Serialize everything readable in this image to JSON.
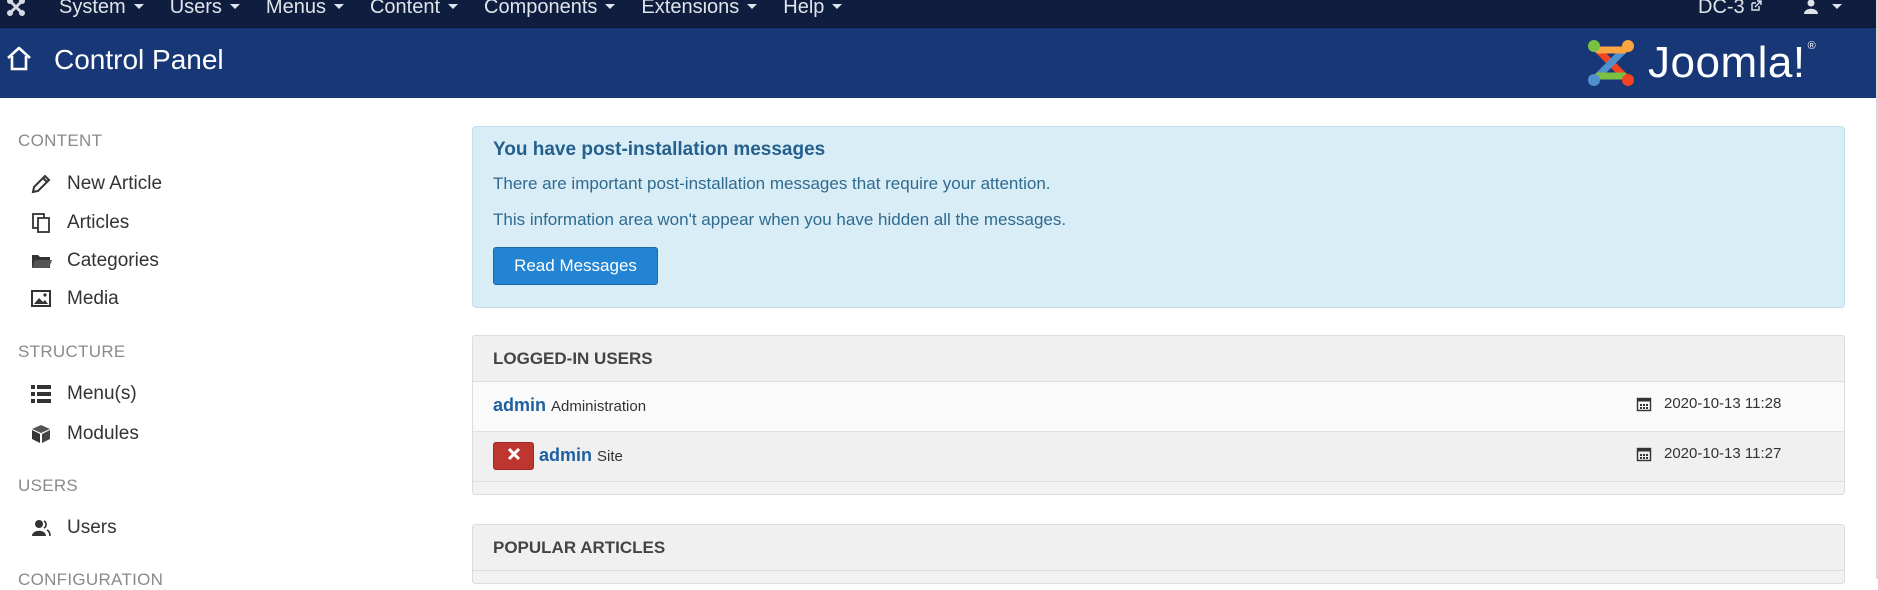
{
  "topnav": {
    "brand_icon": "joomla-icon",
    "menus": [
      {
        "label": "System"
      },
      {
        "label": "Users"
      },
      {
        "label": "Menus"
      },
      {
        "label": "Content"
      },
      {
        "label": "Components"
      },
      {
        "label": "Extensions"
      },
      {
        "label": "Help"
      }
    ],
    "site_link": "DC-3",
    "user_menu_icon": "user-icon"
  },
  "header": {
    "title": "Control Panel",
    "logo_text": "Joomla!",
    "logo_reg": "®"
  },
  "sidebar": {
    "sections": [
      {
        "heading": "CONTENT",
        "items": [
          {
            "label": "New Article",
            "icon": "pencil-icon"
          },
          {
            "label": "Articles",
            "icon": "copy-icon"
          },
          {
            "label": "Categories",
            "icon": "folder-icon"
          },
          {
            "label": "Media",
            "icon": "image-icon"
          }
        ]
      },
      {
        "heading": "STRUCTURE",
        "items": [
          {
            "label": "Menu(s)",
            "icon": "list-icon"
          },
          {
            "label": "Modules",
            "icon": "cube-icon"
          }
        ]
      },
      {
        "heading": "USERS",
        "items": [
          {
            "label": "Users",
            "icon": "users-icon"
          }
        ]
      },
      {
        "heading": "CONFIGURATION",
        "items": []
      }
    ]
  },
  "alert": {
    "heading": "You have post-installation messages",
    "line1": "There are important post-installation messages that require your attention.",
    "line2": "This information area won't appear when you have hidden all the messages.",
    "button_label": "Read Messages"
  },
  "logged_in": {
    "title": "LOGGED-IN USERS",
    "rows": [
      {
        "name": "admin",
        "area": "Administration",
        "time": "2020-10-13 11:28",
        "logout": false
      },
      {
        "name": "admin",
        "area": "Site",
        "time": "2020-10-13 11:27",
        "logout": true
      }
    ]
  },
  "popular": {
    "title": "POPULAR ARTICLES"
  },
  "colors": {
    "topnav_bg": "#0f1e3f",
    "header_bg": "#173777",
    "alert_bg": "#d9edf7",
    "primary_button": "#2384d3",
    "danger_button": "#bd362f",
    "link": "#1f5f9f"
  }
}
